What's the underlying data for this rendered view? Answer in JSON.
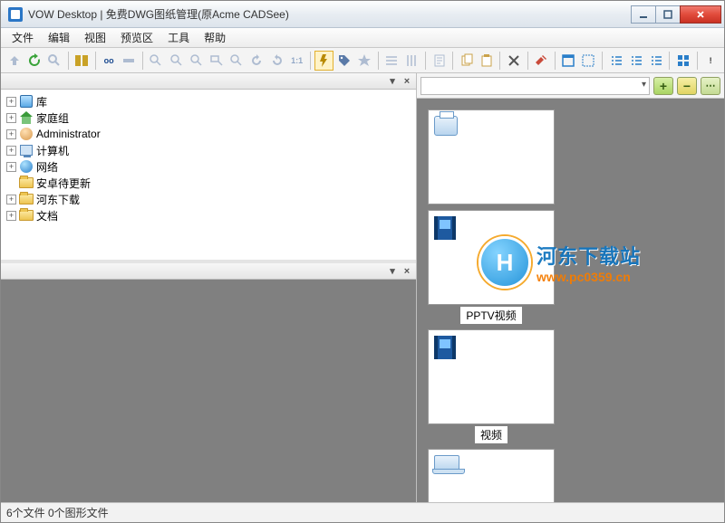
{
  "window": {
    "title": "VOW Desktop | 免费DWG图纸管理(原Acme CADSee)"
  },
  "menu": [
    "文件",
    "编辑",
    "视图",
    "预览区",
    "工具",
    "帮助"
  ],
  "toolbar": [
    {
      "name": "nav-up-icon",
      "kind": "arrow-up",
      "dim": true
    },
    {
      "name": "refresh-icon",
      "kind": "refresh",
      "color": "#3aa33a"
    },
    {
      "name": "search-icon",
      "kind": "search",
      "dim": true
    },
    {
      "sep": true
    },
    {
      "name": "panels-icon",
      "kind": "panels",
      "color": "#c9a227"
    },
    {
      "sep": true
    },
    {
      "name": "view-mode-icon",
      "kind": "oo",
      "text": "oo"
    },
    {
      "name": "view-toggle-icon",
      "kind": "bar",
      "dim": true
    },
    {
      "sep": true
    },
    {
      "name": "zoom-in-icon",
      "kind": "zoom",
      "dim": true
    },
    {
      "name": "zoom-out-icon",
      "kind": "zoom",
      "dim": true
    },
    {
      "name": "zoom-fit-icon",
      "kind": "zoom",
      "dim": true
    },
    {
      "name": "zoom-rect-icon",
      "kind": "zoomrect",
      "dim": true
    },
    {
      "name": "zoom-all-icon",
      "kind": "zoom",
      "dim": true
    },
    {
      "name": "rotate-ccw-icon",
      "kind": "rotccw",
      "dim": true
    },
    {
      "name": "rotate-cw-icon",
      "kind": "rotcw",
      "dim": true
    },
    {
      "name": "scale-11-icon",
      "kind": "text",
      "text": "1:1",
      "dim": true
    },
    {
      "sep": true
    },
    {
      "name": "highlight-icon",
      "kind": "flash",
      "active": true,
      "color": "#b88a00"
    },
    {
      "name": "tag-icon",
      "kind": "tag",
      "color": "#5a7aa8"
    },
    {
      "name": "star-icon",
      "kind": "star",
      "dim": true
    },
    {
      "sep": true
    },
    {
      "name": "halign-icon",
      "kind": "halign",
      "dim": true
    },
    {
      "name": "valign-icon",
      "kind": "valign",
      "dim": true
    },
    {
      "sep": true
    },
    {
      "name": "doc-icon",
      "kind": "doc",
      "dim": true
    },
    {
      "sep": true
    },
    {
      "name": "copy-icon",
      "kind": "copy",
      "color": "#caa24a"
    },
    {
      "name": "paste-icon",
      "kind": "paste",
      "color": "#caa24a"
    },
    {
      "sep": true
    },
    {
      "name": "delete-icon",
      "kind": "x",
      "color": "#555"
    },
    {
      "sep": true
    },
    {
      "name": "hammer-icon",
      "kind": "hammer",
      "color": "#c94a3a"
    },
    {
      "sep": true
    },
    {
      "name": "window-icon",
      "kind": "win",
      "color": "#2a7ec9"
    },
    {
      "name": "bounds-icon",
      "kind": "bounds",
      "color": "#2a7ec9"
    },
    {
      "sep": true
    },
    {
      "name": "list1-icon",
      "kind": "list",
      "color": "#2a7ec9"
    },
    {
      "name": "list2-icon",
      "kind": "list",
      "color": "#2a7ec9"
    },
    {
      "name": "list3-icon",
      "kind": "list",
      "color": "#2a7ec9"
    },
    {
      "sep": true
    },
    {
      "name": "grid-icon",
      "kind": "grid",
      "color": "#2a7ec9"
    },
    {
      "sep": true
    },
    {
      "name": "help-icon",
      "kind": "text",
      "text": "!",
      "color": "#333"
    }
  ],
  "tree": [
    {
      "exp": "+",
      "icon": "lib",
      "label": "库"
    },
    {
      "exp": "+",
      "icon": "home",
      "label": "家庭组"
    },
    {
      "exp": "+",
      "icon": "user",
      "label": "Administrator"
    },
    {
      "exp": "+",
      "icon": "pc",
      "label": "计算机"
    },
    {
      "exp": "+",
      "icon": "net",
      "label": "网络"
    },
    {
      "exp": "",
      "icon": "folder",
      "label": "安卓待更新"
    },
    {
      "exp": "+",
      "icon": "folder",
      "label": "河东下载"
    },
    {
      "exp": "+",
      "icon": "folder",
      "label": "文档"
    }
  ],
  "thumbs": [
    {
      "icon": "printer",
      "caption": "",
      "short": false
    },
    {
      "icon": "film",
      "caption": "PPTV视频",
      "short": false
    },
    {
      "icon": "film",
      "caption": "视频",
      "short": false
    },
    {
      "icon": "laptop",
      "caption": "",
      "short": true
    }
  ],
  "pathbar": {
    "value": ""
  },
  "watermark": {
    "line1": "河东下载站",
    "line2": "www.pc0359.cn",
    "badge": "H"
  },
  "status": "6个文件  0个图形文件"
}
